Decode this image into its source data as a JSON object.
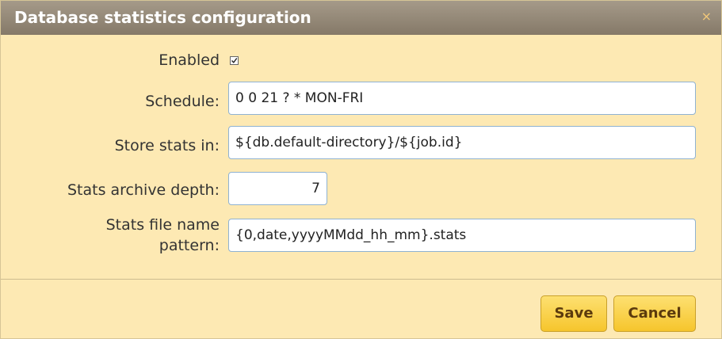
{
  "dialog": {
    "title": "Database statistics configuration",
    "close_glyph": "×"
  },
  "form": {
    "enabled_label": "Enabled",
    "enabled_checked": true,
    "schedule_label": "Schedule:",
    "schedule_value": "0 0 21 ? * MON-FRI",
    "store_label": "Store stats in:",
    "store_value": "${db.default-directory}/${job.id}",
    "depth_label": "Stats archive depth:",
    "depth_value": "7",
    "pattern_label_line1": "Stats file name",
    "pattern_label_line2": "pattern:",
    "pattern_value": "{0,date,yyyyMMdd_hh_mm}.stats"
  },
  "buttons": {
    "save_label": "Save",
    "cancel_label": "Cancel"
  },
  "colors": {
    "dialog_bg": "#fde9b3",
    "titlebar": "#968b79",
    "button": "#f8cf3f",
    "input_border": "#8fb2d2"
  }
}
